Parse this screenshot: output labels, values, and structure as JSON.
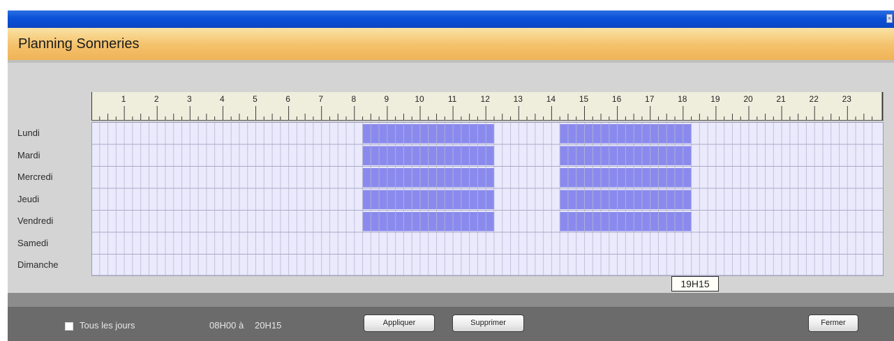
{
  "window": {
    "close_glyph": "×",
    "title": "Planning Sonneries"
  },
  "ruler": {
    "hours": [
      "1",
      "2",
      "3",
      "4",
      "5",
      "6",
      "7",
      "8",
      "9",
      "10",
      "11",
      "12",
      "13",
      "14",
      "15",
      "16",
      "17",
      "18",
      "19",
      "20",
      "21",
      "22",
      "23"
    ]
  },
  "days": [
    "Lundi",
    "Mardi",
    "Mercredi",
    "Jeudi",
    "Vendredi",
    "Samedi",
    "Dimanche"
  ],
  "schedule": [
    {
      "day": "Lundi",
      "ranges": [
        [
          "08H15",
          "12H15"
        ],
        [
          "14H15",
          "18H15"
        ]
      ]
    },
    {
      "day": "Mardi",
      "ranges": [
        [
          "08H15",
          "12H15"
        ],
        [
          "14H15",
          "18H15"
        ]
      ]
    },
    {
      "day": "Mercredi",
      "ranges": [
        [
          "08H15",
          "12H15"
        ],
        [
          "14H15",
          "18H15"
        ]
      ]
    },
    {
      "day": "Jeudi",
      "ranges": [
        [
          "08H15",
          "12H15"
        ],
        [
          "14H15",
          "18H15"
        ]
      ]
    },
    {
      "day": "Vendredi",
      "ranges": [
        [
          "08H15",
          "12H15"
        ],
        [
          "14H15",
          "18H15"
        ]
      ]
    },
    {
      "day": "Samedi",
      "ranges": []
    },
    {
      "day": "Dimanche",
      "ranges": []
    }
  ],
  "hover_tooltip": "19H15",
  "footer": {
    "all_days_label": "Tous les jours",
    "time_from": "08H00",
    "time_separator": "à",
    "time_to": "20H15",
    "apply_label": "Appliquer",
    "delete_label": "Supprimer",
    "close_label": "Fermer"
  },
  "colors": {
    "grid_background": "#eaeafc",
    "grid_line": "#b6b6d2",
    "active_slot": "#8a8aee",
    "active_slot_line": "#aaaaf4",
    "ruler_background": "#efeedd"
  }
}
